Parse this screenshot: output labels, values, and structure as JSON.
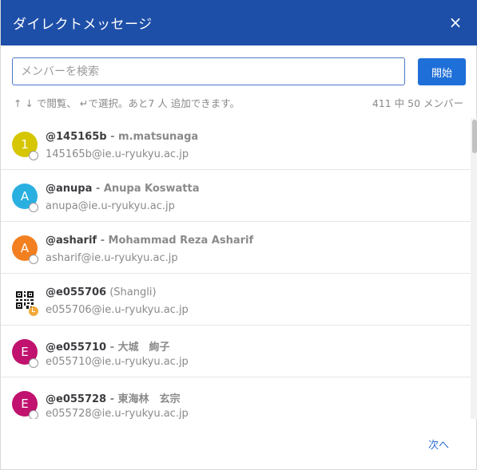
{
  "dialog": {
    "title": "ダイレクトメッセージ",
    "close_glyph": "×"
  },
  "search": {
    "placeholder": "メンバーを検索",
    "value": ""
  },
  "start_button": {
    "label": "開始"
  },
  "hint": "↑ ↓ で閲覧、 ↵で選択。あと7 人 追加できます。",
  "member_count": "411 中 50 メンバー",
  "colors": {
    "header": "#1e4fa8",
    "primary_button": "#1f6fd8",
    "link": "#2f6fd1"
  },
  "members": [
    {
      "avatar_letter": "1",
      "avatar_color": "#d6c600",
      "username": "@145165b",
      "fullname": " - m.matsunaga",
      "email": "145165b@ie.u-ryukyu.ac.jp",
      "status": "offline"
    },
    {
      "avatar_letter": "A",
      "avatar_color": "#2ab0e0",
      "username": "@anupa",
      "fullname": " - Anupa Koswatta",
      "email": "anupa@ie.u-ryukyu.ac.jp",
      "status": "offline"
    },
    {
      "avatar_letter": "A",
      "avatar_color": "#f28021",
      "username": "@asharif",
      "fullname": " - Mohammad Reza Asharif",
      "email": "asharif@ie.u-ryukyu.ac.jp",
      "status": "offline"
    },
    {
      "avatar_letter": "",
      "avatar_color": "qr-image",
      "username": "@e055706",
      "fullname": " (Shangli)",
      "email": "e055706@ie.u-ryukyu.ac.jp",
      "status": "away"
    },
    {
      "avatar_letter": "E",
      "avatar_color": "#c0126e",
      "username": "@e055710",
      "fullname": " - 大城　絢子",
      "email": "e055710@ie.u-ryukyu.ac.jp",
      "status": "offline"
    },
    {
      "avatar_letter": "E",
      "avatar_color": "#c0126e",
      "username": "@e055728",
      "fullname": " - 東海林　玄宗",
      "email": "e055728@ie.u-ryukyu.ac.jp",
      "status": "offline"
    }
  ],
  "pagination": {
    "next_label": "次へ"
  }
}
